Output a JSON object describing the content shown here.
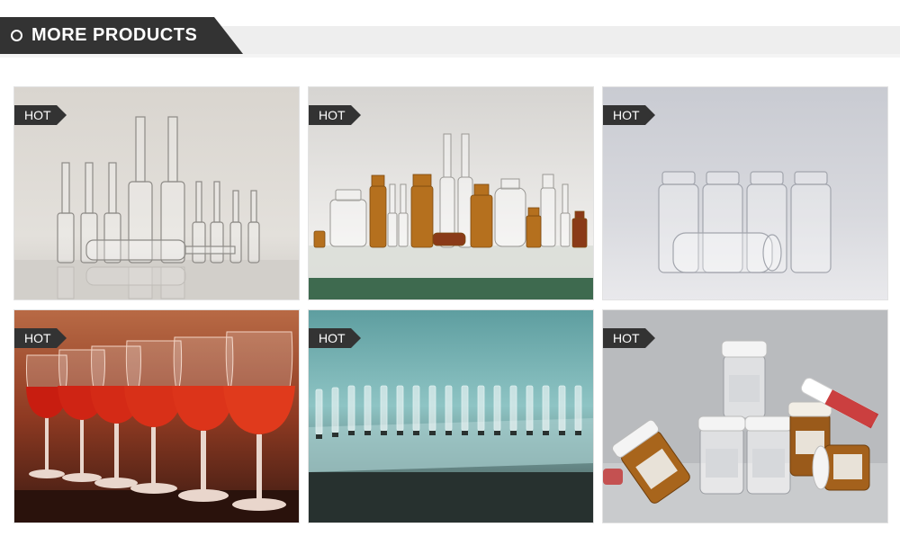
{
  "header": {
    "title": "MORE PRODUCTS"
  },
  "products": [
    {
      "badge": "HOT",
      "image": "clear-glass-ampoules"
    },
    {
      "badge": "HOT",
      "image": "amber-and-clear-vials"
    },
    {
      "badge": "HOT",
      "image": "clear-tubular-vials"
    },
    {
      "badge": "HOT",
      "image": "red-wine-glasses"
    },
    {
      "badge": "HOT",
      "image": "ampoule-production-line"
    },
    {
      "badge": "HOT",
      "image": "cosmetic-serum-vials"
    }
  ],
  "colors": {
    "tab": "#333333",
    "header_bar": "#eeeeee",
    "badge": "#333333"
  }
}
